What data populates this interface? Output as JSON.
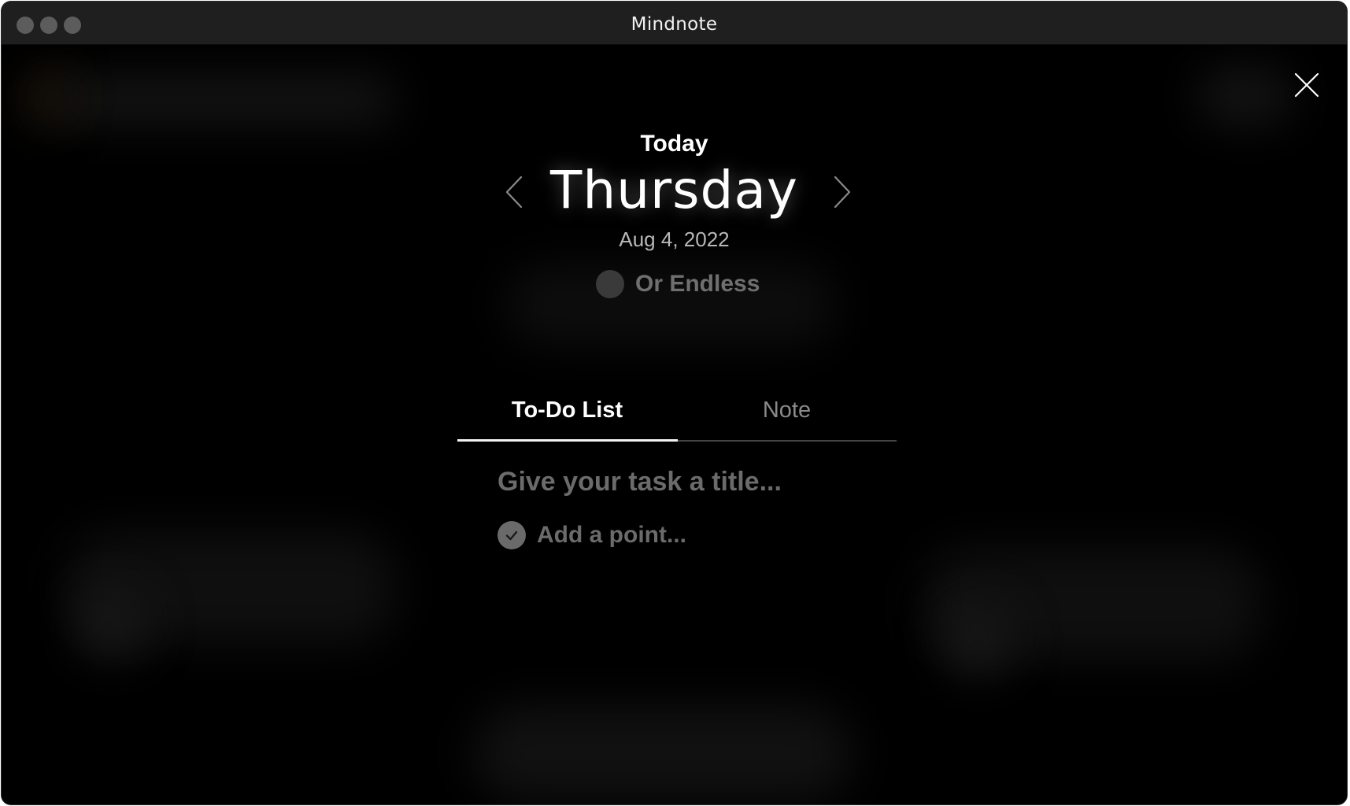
{
  "window": {
    "title": "Mindnote"
  },
  "header": {
    "today_label": "Today",
    "day_name": "Thursday",
    "date": "Aug 4, 2022"
  },
  "endless_toggle": {
    "label": "Or Endless",
    "enabled": false
  },
  "tabs": [
    {
      "label": "To-Do List",
      "active": true
    },
    {
      "label": "Note",
      "active": false
    }
  ],
  "task": {
    "title_placeholder": "Give your task a title...",
    "point_placeholder": "Add a point..."
  },
  "icons": {
    "close": "close-icon",
    "prev": "chevron-left-icon",
    "next": "chevron-right-icon",
    "check": "check-icon"
  },
  "colors": {
    "background": "#000000",
    "titlebar": "#1f1f1f",
    "text_primary": "#ffffff",
    "text_muted": "#6b6b6b"
  }
}
